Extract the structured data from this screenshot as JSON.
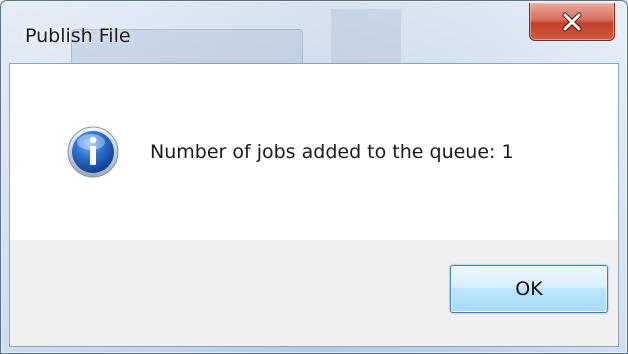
{
  "window": {
    "title": "Publish File",
    "close_icon": "close-icon",
    "accent_close": "#c8412c"
  },
  "content": {
    "icon": "info-icon",
    "message": "Number of jobs added to the queue: 1"
  },
  "buttons": {
    "ok_label": "OK"
  },
  "colors": {
    "title_bar": "#b9cde6",
    "button_strip": "#f0f0f0",
    "info_blue": "#1f5fc2"
  }
}
